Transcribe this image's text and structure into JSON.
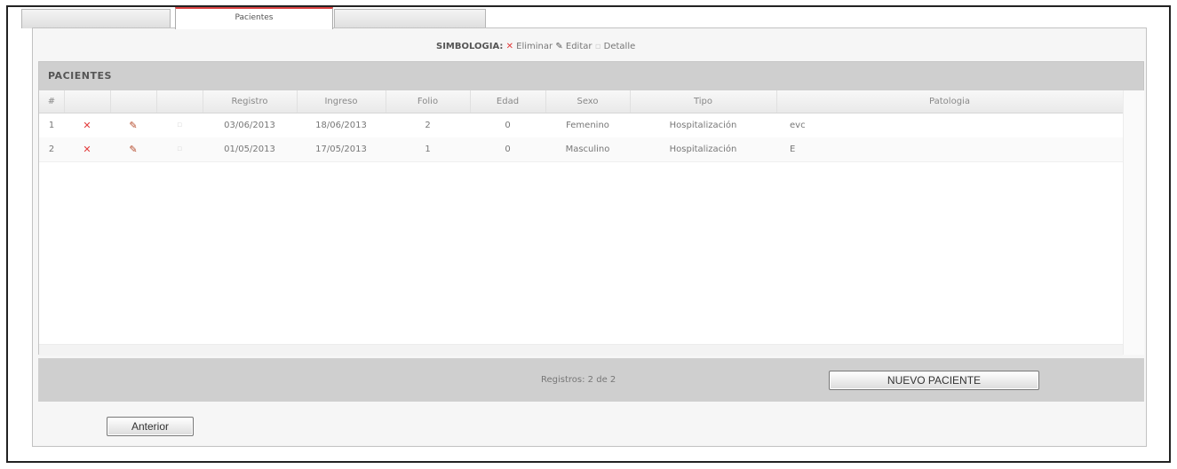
{
  "tabs": [
    {
      "label": ""
    },
    {
      "label": "Pacientes"
    },
    {
      "label": ""
    }
  ],
  "legend": {
    "title": "SIMBOLOGIA:",
    "eliminar": "Eliminar",
    "editar": "Editar",
    "detalle": "Detalle"
  },
  "grid": {
    "caption": "PACIENTES",
    "columns": [
      "#",
      "",
      "",
      "",
      "Registro",
      "Ingreso",
      "Folio",
      "Edad",
      "Sexo",
      "Tipo",
      "Patologia"
    ],
    "rows": [
      {
        "num": "1",
        "registro": "03/06/2013",
        "ingreso": "18/06/2013",
        "folio": "2",
        "edad": "0",
        "sexo": "Femenino",
        "tipo": "Hospitalización",
        "patologia": "evc"
      },
      {
        "num": "2",
        "registro": "01/05/2013",
        "ingreso": "17/05/2013",
        "folio": "1",
        "edad": "0",
        "sexo": "Masculino",
        "tipo": "Hospitalización",
        "patologia": "E"
      }
    ],
    "icons": {
      "delete": "delete-icon",
      "edit": "edit-icon",
      "detail": "detail-icon"
    }
  },
  "footer": {
    "records": "Registros: 2 de 2",
    "new_button": "NUEVO PACIENTE"
  },
  "nav": {
    "prev_button": "Anterior"
  },
  "colors": {
    "accent_red": "#e23b3b",
    "bar_gray": "#cfcfcf"
  }
}
